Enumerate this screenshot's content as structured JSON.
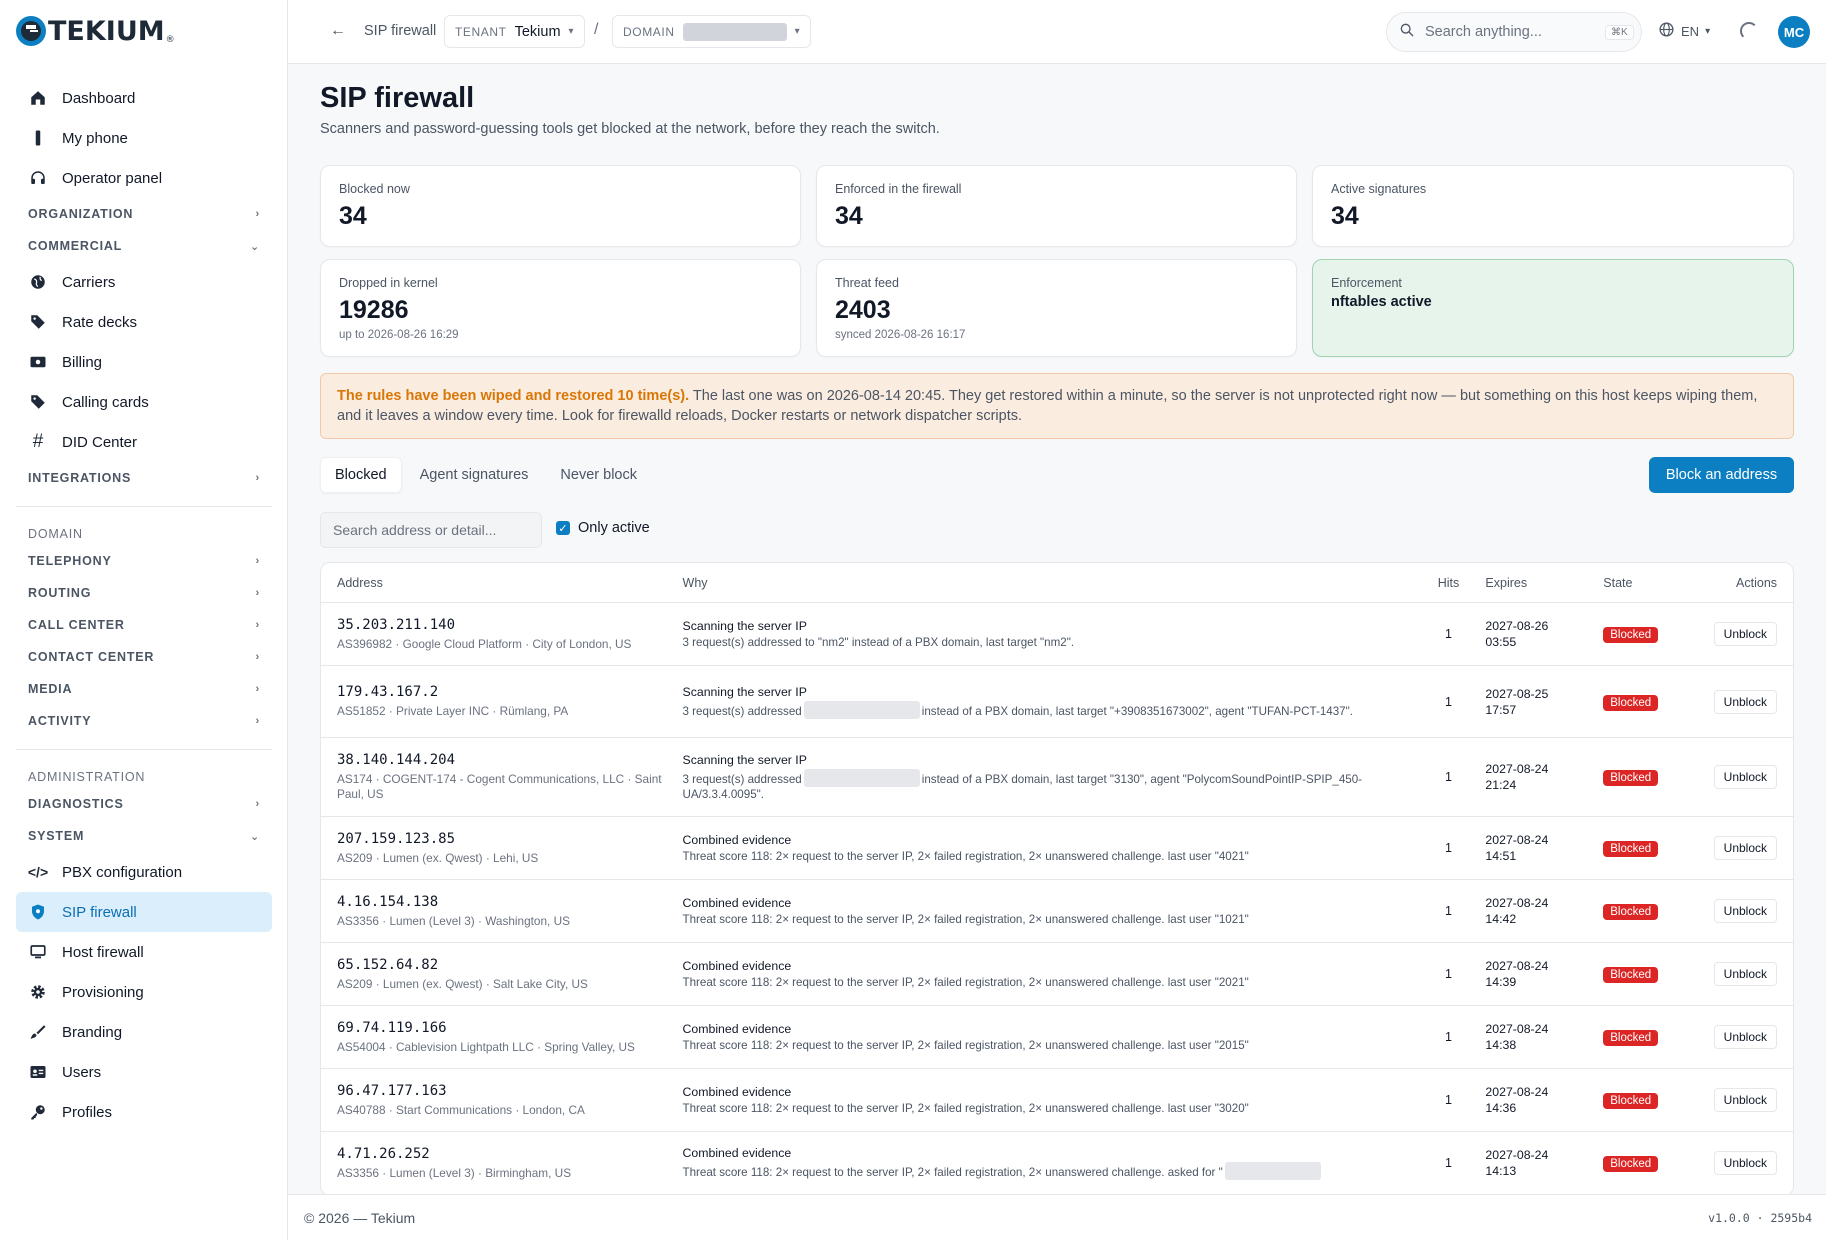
{
  "brand": {
    "name": "TEKIUM",
    "mark": "®",
    "accent": "#0b7fc2"
  },
  "sidebar": {
    "top_items": [
      {
        "label": "Dashboard",
        "icon": "home-icon"
      },
      {
        "label": "My phone",
        "icon": "phone-icon"
      },
      {
        "label": "Operator panel",
        "icon": "headset-icon"
      }
    ],
    "organization": "ORGANIZATION",
    "commercial": "COMMERCIAL",
    "commercial_items": [
      {
        "label": "Carriers",
        "icon": "globe-icon"
      },
      {
        "label": "Rate decks",
        "icon": "tag-icon"
      },
      {
        "label": "Billing",
        "icon": "money-icon"
      },
      {
        "label": "Calling cards",
        "icon": "tag-icon"
      },
      {
        "label": "DID Center",
        "icon": "hash-icon"
      }
    ],
    "integrations": "INTEGRATIONS",
    "domain_label": "DOMAIN",
    "domain_sections": [
      "TELEPHONY",
      "ROUTING",
      "CALL CENTER",
      "CONTACT CENTER",
      "MEDIA",
      "ACTIVITY"
    ],
    "administration_label": "ADMINISTRATION",
    "diagnostics": "DIAGNOSTICS",
    "system": "SYSTEM",
    "system_items": [
      {
        "label": "PBX configuration",
        "icon": "code-icon"
      },
      {
        "label": "SIP firewall",
        "icon": "shield-icon",
        "active": true
      },
      {
        "label": "Host firewall",
        "icon": "monitor-icon"
      },
      {
        "label": "Provisioning",
        "icon": "gear-icon"
      },
      {
        "label": "Branding",
        "icon": "brush-icon"
      },
      {
        "label": "Users",
        "icon": "id-card-icon"
      },
      {
        "label": "Profiles",
        "icon": "key-icon"
      }
    ]
  },
  "topbar": {
    "breadcrumb": "SIP firewall",
    "tenant_label": "TENANT",
    "tenant_value": "Tekium",
    "domain_label": "DOMAIN",
    "search_placeholder": "Search anything...",
    "search_shortcut": "⌘K",
    "language": "EN",
    "user_initials": "MC"
  },
  "page": {
    "title": "SIP firewall",
    "subtitle": "Scanners and password-guessing tools get blocked at the network, before they reach the switch."
  },
  "stats": [
    {
      "label": "Blocked now",
      "value": "34"
    },
    {
      "label": "Enforced in the firewall",
      "value": "34"
    },
    {
      "label": "Active signatures",
      "value": "34"
    },
    {
      "label": "Dropped in kernel",
      "value": "19286",
      "sub": "up to 2026-08-26 16:29"
    },
    {
      "label": "Threat feed",
      "value": "2403",
      "sub": "synced 2026-08-26 16:17"
    },
    {
      "label": "Enforcement",
      "value": "nftables active"
    }
  ],
  "alert": {
    "strong": "The rules have been wiped and restored 10 time(s).",
    "text": " The last one was on 2026-08-14 20:45. They get restored within a minute, so the server is not unprotected right now — but something on this host keeps wiping them, and it leaves a window every time. Look for firewalld reloads, Docker restarts or network dispatcher scripts."
  },
  "tabs": [
    "Blocked",
    "Agent signatures",
    "Never block"
  ],
  "block_button": "Block an address",
  "filter": {
    "placeholder": "Search address or detail...",
    "only_active": "Only active"
  },
  "table": {
    "headers": [
      "Address",
      "Why",
      "Hits",
      "Expires",
      "State",
      "Actions"
    ],
    "rows": [
      {
        "ip": "35.203.211.140",
        "meta": "AS396982 · Google Cloud Platform · City of London, US",
        "why": "Scanning the server IP",
        "d1": "3 request(s) addressed to \"nm2\" instead of a PBX domain, last target \"nm2\".",
        "d2": "",
        "hits": "1",
        "exp1": "2027-08-26",
        "exp2": "03:55",
        "state": "Blocked",
        "action": "Unblock"
      },
      {
        "ip": "179.43.167.2",
        "meta": "AS51852 · Private Layer INC · Rümlang, PA",
        "why": "Scanning the server IP",
        "d1": "3 request(s) addressed",
        "d2": "instead of a PBX domain, last target \"+3908351673002\", agent \"TUFAN-PCT-1437\".",
        "hits": "1",
        "exp1": "2027-08-25",
        "exp2": "17:57",
        "state": "Blocked",
        "action": "Unblock"
      },
      {
        "ip": "38.140.144.204",
        "meta": "AS174 · COGENT-174 - Cogent Communications, LLC · Saint Paul, US",
        "why": "Scanning the server IP",
        "d1": "3 request(s) addressed",
        "d2": "instead of a PBX domain, last target \"3130\", agent \"PolycomSoundPointIP-SPIP_450-UA/3.3.4.0095\".",
        "hits": "1",
        "exp1": "2027-08-24",
        "exp2": "21:24",
        "state": "Blocked",
        "action": "Unblock"
      },
      {
        "ip": "207.159.123.85",
        "meta": "AS209 · Lumen (ex. Qwest) · Lehi, US",
        "why": "Combined evidence",
        "d1": "Threat score 118: 2× request to the server IP, 2× failed registration, 2× unanswered challenge. last user \"4021\"",
        "d2": "",
        "hits": "1",
        "exp1": "2027-08-24",
        "exp2": "14:51",
        "state": "Blocked",
        "action": "Unblock"
      },
      {
        "ip": "4.16.154.138",
        "meta": "AS3356 · Lumen (Level 3) · Washington, US",
        "why": "Combined evidence",
        "d1": "Threat score 118: 2× request to the server IP, 2× failed registration, 2× unanswered challenge. last user \"1021\"",
        "d2": "",
        "hits": "1",
        "exp1": "2027-08-24",
        "exp2": "14:42",
        "state": "Blocked",
        "action": "Unblock"
      },
      {
        "ip": "65.152.64.82",
        "meta": "AS209 · Lumen (ex. Qwest) · Salt Lake City, US",
        "why": "Combined evidence",
        "d1": "Threat score 118: 2× request to the server IP, 2× failed registration, 2× unanswered challenge. last user \"2021\"",
        "d2": "",
        "hits": "1",
        "exp1": "2027-08-24",
        "exp2": "14:39",
        "state": "Blocked",
        "action": "Unblock"
      },
      {
        "ip": "69.74.119.166",
        "meta": "AS54004 · Cablevision Lightpath LLC · Spring Valley, US",
        "why": "Combined evidence",
        "d1": "Threat score 118: 2× request to the server IP, 2× failed registration, 2× unanswered challenge. last user \"2015\"",
        "d2": "",
        "hits": "1",
        "exp1": "2027-08-24",
        "exp2": "14:38",
        "state": "Blocked",
        "action": "Unblock"
      },
      {
        "ip": "96.47.177.163",
        "meta": "AS40788 · Start Communications · London, CA",
        "why": "Combined evidence",
        "d1": "Threat score 118: 2× request to the server IP, 2× failed registration, 2× unanswered challenge. last user \"3020\"",
        "d2": "",
        "hits": "1",
        "exp1": "2027-08-24",
        "exp2": "14:36",
        "state": "Blocked",
        "action": "Unblock"
      },
      {
        "ip": "4.71.26.252",
        "meta": "AS3356 · Lumen (Level 3) · Birmingham, US",
        "why": "Combined evidence",
        "d1": "Threat score 118: 2× request to the server IP, 2× failed registration, 2× unanswered challenge. asked for \"",
        "d2": "",
        "hits": "1",
        "exp1": "2027-08-24",
        "exp2": "14:13",
        "state": "Blocked",
        "action": "Unblock"
      }
    ]
  },
  "footer": {
    "copyright": "© 2026 — Tekium",
    "version": "v1.0.0 · 2595b4"
  }
}
